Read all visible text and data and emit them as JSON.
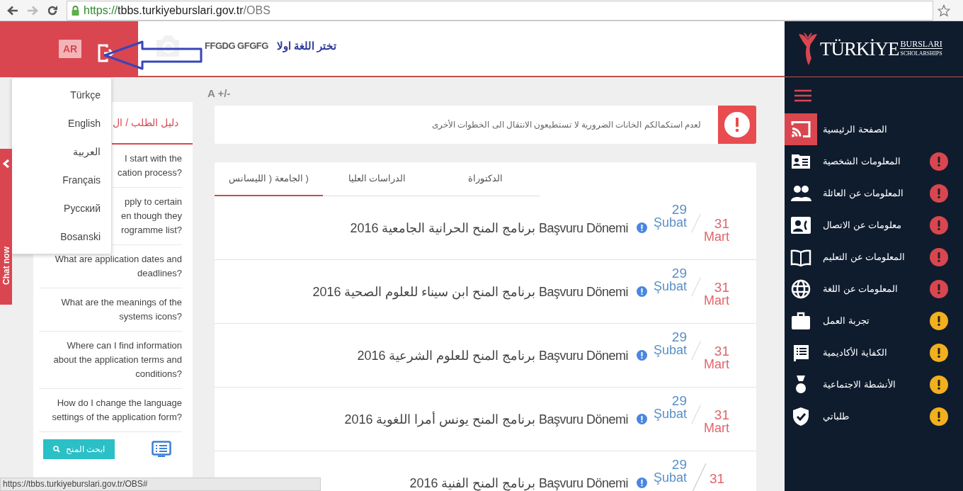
{
  "browser": {
    "forward_disabled": true,
    "url_scheme": "https://",
    "url_host": "tbbs.turkiyeburslari.gov.tr",
    "url_path": "/OBS"
  },
  "header": {
    "language_badge": "AR",
    "user_name": "FFGDG GFGFG",
    "annotation": "تختر اللغة اولا"
  },
  "language_menu": [
    "Türkçe",
    "English",
    "العربية",
    "Français",
    "Русский",
    "Bosanski"
  ],
  "chat_tab": {
    "label": "Chat now"
  },
  "guide": {
    "title": "دليل الطلب / ال",
    "questions": [
      {
        "lines": [
          "I start with the",
          "cation process?"
        ]
      },
      {
        "lines": [
          "pply to certain",
          "en though they",
          "rogramme list?"
        ]
      },
      {
        "lines": [
          "What are application dates and",
          "deadlines?"
        ]
      },
      {
        "lines": [
          "What are the meanings of the",
          "systems icons?"
        ]
      },
      {
        "lines": [
          "Where can I find information",
          "about the application terms and",
          "conditions?"
        ]
      },
      {
        "lines": [
          "How do I change the language",
          "settings of the application form?"
        ]
      }
    ],
    "search_button": "ابحث المنح"
  },
  "font_size_control": "A +/-",
  "alert": {
    "message": "لعدم استكمالكم الخانات الضرورية لا تستطيعون الانتقال الى الخطوات الأخرى"
  },
  "tabs": [
    {
      "label": "الدكتوراة",
      "selected": false
    },
    {
      "label": "الدراسات العليا",
      "selected": false
    },
    {
      "label": "( الجامعة ( الليسانس",
      "selected": true
    }
  ],
  "rows": [
    {
      "title": "Başvuru Dönemi برنامج المنح الحرانية الجامعية 2016",
      "start_day": "29",
      "start_month": "Şubat",
      "end_day": "31",
      "end_month": "Mart"
    },
    {
      "title": "Başvuru Dönemi برنامج المنح ابن سيناء للعلوم الصحية 2016",
      "start_day": "29",
      "start_month": "Şubat",
      "end_day": "31",
      "end_month": "Mart"
    },
    {
      "title": "Başvuru Dönemi برنامج المنح للعلوم الشرعية 2016",
      "start_day": "29",
      "start_month": "Şubat",
      "end_day": "31",
      "end_month": "Mart"
    },
    {
      "title": "Başvuru Dönemi برنامج المنح يونس أمرا اللغوية 2016",
      "start_day": "29",
      "start_month": "Şubat",
      "end_day": "31",
      "end_month": "Mart"
    },
    {
      "title": "Başvuru Dönemi برنامج المنح الفنية 2016",
      "start_day": "29",
      "start_month": "Şubat",
      "end_day": "31"
    }
  ],
  "sidebar": {
    "logo": {
      "name": "TÜRKİYE",
      "line1": "BURSLARI",
      "line2": "SCHOLARSHIPS"
    },
    "items": [
      {
        "label": "الصفحة الرئيسية",
        "selected": true
      },
      {
        "label": "المعلومات الشخصية",
        "selected": false,
        "color": "#d9464f"
      },
      {
        "label": "المعلومات عن العائلة",
        "selected": false,
        "color": "#d9464f"
      },
      {
        "label": "معلومات عن الاتصال",
        "selected": false,
        "color": "#d9464f"
      },
      {
        "label": "المعلومات عن التعليم",
        "selected": false,
        "color": "#d9464f"
      },
      {
        "label": "المعلومات عن اللغة",
        "selected": false,
        "color": "#d9464f"
      },
      {
        "label": "تجربة العمل",
        "selected": false,
        "color": "#f2b01e"
      },
      {
        "label": "الكفاية الأكاديمية",
        "selected": false,
        "color": "#f2b01e"
      },
      {
        "label": "الأنشطة الاجتماعية",
        "selected": false,
        "color": "#f2b01e"
      },
      {
        "label": "طلباتي",
        "selected": false,
        "color": "#f2b01e"
      }
    ]
  },
  "status_bar": "https://tbbs.turkiyeburslari.gov.tr/OBS#"
}
